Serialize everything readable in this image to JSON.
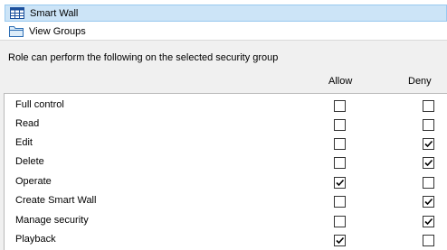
{
  "tree": {
    "items": [
      {
        "label": "Smart Wall",
        "icon": "grid-table-icon",
        "selected": true
      },
      {
        "label": "View Groups",
        "icon": "folder-icon",
        "selected": false
      }
    ]
  },
  "permissions": {
    "title": "Role can perform the following on the selected security group",
    "columns": {
      "allow": "Allow",
      "deny": "Deny"
    },
    "rows": [
      {
        "label": "Full control",
        "allow": false,
        "deny": false
      },
      {
        "label": "Read",
        "allow": false,
        "deny": false
      },
      {
        "label": "Edit",
        "allow": false,
        "deny": true
      },
      {
        "label": "Delete",
        "allow": false,
        "deny": true
      },
      {
        "label": "Operate",
        "allow": true,
        "deny": false
      },
      {
        "label": "Create Smart Wall",
        "allow": false,
        "deny": true
      },
      {
        "label": "Manage security",
        "allow": false,
        "deny": true
      },
      {
        "label": "Playback",
        "allow": true,
        "deny": false
      }
    ]
  },
  "colors": {
    "selection_bg": "#cce4f7",
    "selection_border": "#99c9ef",
    "panel_bg": "#f0f0f0"
  }
}
